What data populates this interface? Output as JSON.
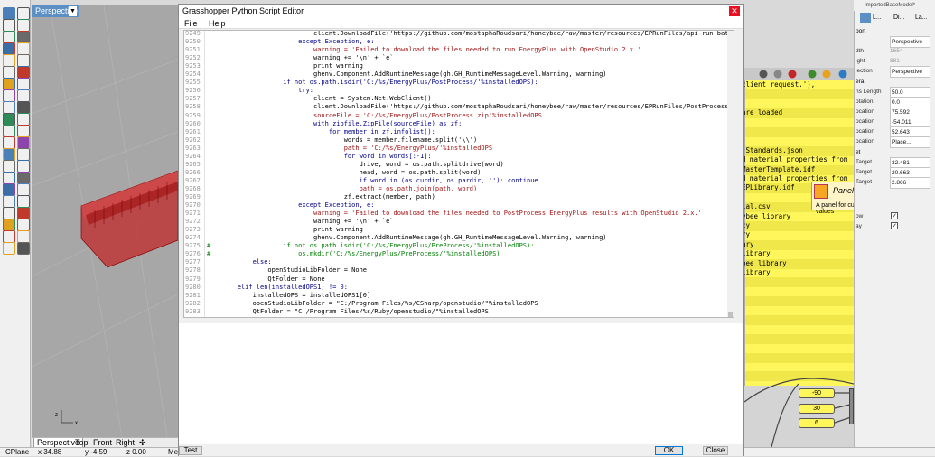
{
  "rhino": {
    "viewport_label": "Perspective",
    "view_tabs": [
      "Perspective",
      "Top",
      "Front",
      "Right"
    ],
    "status": {
      "cplane": "CPlane",
      "x": "x 34.88",
      "y": "y -4.59",
      "z": "z 0.00",
      "units": "Me"
    }
  },
  "editor": {
    "title": "Grasshopper Python Script Editor",
    "menu": [
      "File",
      "Help"
    ],
    "test_label": "Test",
    "ok_label": "OK",
    "close_label": "Close",
    "line_numbers": [
      "9249",
      "9250",
      "9251",
      "9252",
      "9253",
      "9254",
      "9255",
      "9256",
      "9257",
      "9258",
      "9259",
      "9260",
      "9261",
      "9262",
      "9263",
      "9264",
      "9265",
      "9266",
      "9267",
      "9268",
      "9269",
      "9270",
      "9271",
      "9272",
      "9273",
      "9274",
      "9275",
      "9276",
      "9277",
      "9278",
      "9279",
      "9280",
      "9281",
      "9282",
      "9283"
    ],
    "code_lines": [
      "                            client.DownloadFile('https://github.com/mostaphaRoudsari/honeybee/raw/master/resources/EPRunFiles/api-run.bat",
      "                        except Exception, e:",
      "                            warning = 'Failed to download the files needed to run EnergyPlus with OpenStudio 2.x.'",
      "                            warning += '\\n' + `e`",
      "                            print warning",
      "                            ghenv.Component.AddRuntimeMessage(gh.GH_RuntimeMessageLevel.Warning, warning)",
      "                    if not os.path.isdir('C:/%s/EnergyPlus/PostProcess/'%installedOPS):",
      "                        try:",
      "                            client = System.Net.WebClient()",
      "                            client.DownloadFile('https://github.com/mostaphaRoudsari/honeybee/raw/master/resources/EPRunFiles/PostProcess",
      "                            sourceFile = 'C:/%s/EnergyPlus/PostProcess.zip'%installedOPS",
      "                            with zipfile.ZipFile(sourceFile) as zf:",
      "                                for member in zf.infolist():",
      "                                    words = member.filename.split('\\\\')",
      "                                    path = 'C:/%s/EnergyPlus/'%installedOPS",
      "                                    for word in words[:-1]:",
      "                                        drive, word = os.path.splitdrive(word)",
      "                                        head, word = os.path.split(word)",
      "                                        if word in (os.curdir, os.pardir, ''): continue",
      "                                        path = os.path.join(path, word)",
      "                                    zf.extract(member, path)",
      "                        except Exception, e:",
      "                            warning = 'Failed to download the files needed to PostProcess EnergyPlus results with OpenStudio 2.x.'",
      "                            warning += '\\n' + `e`",
      "                            print warning",
      "                            ghenv.Component.AddRuntimeMessage(gh.GH_RuntimeMessageLevel.Warning, warning)",
      "#                   if not os.path.isdir('C:/%s/EnergyPlus/PreProcess/'%installedOPS):",
      "#                       os.mkdir('C:/%s/EnergyPlus/PreProcess/'%installedOPS)",
      "            else:",
      "                openStudioLibFolder = None",
      "                QtFolder = None",
      "        elif len(installedOPS1) != 0:",
      "            installedOPS = installedOPS1[0]",
      "            openStudioLibFolder = \"C:/Program Files/%s/CSharp/openstudio/\"%installedOPS",
      "            QtFolder = \"C:/Program Files/%s/Ruby/openstudio/\"%installedOPS"
    ]
  },
  "grasshopper": {
    "panel_lines": [
      "client request.'),",
      "",
      "",
      "are loaded",
      "",
      "",
      "",
      "_Standards.json",
      "d material properties from",
      "MasterTemplate.idf",
      "d material properties from",
      "EPLibrary.idf",
      "",
      "ial.csv",
      "ybee library",
      "cy",
      "ry",
      "ary",
      "library",
      "bee library",
      "library"
    ],
    "sliders": [
      "-90",
      "30",
      "6"
    ],
    "tooltip": {
      "title": "Panel ()",
      "description": "A panel for custom notes and text values"
    }
  },
  "properties": {
    "window_title": "ImportedBaseModel*",
    "tabs": [
      "L...",
      "Di...",
      "La..."
    ],
    "section_viewport": "port",
    "rows": [
      {
        "key": "",
        "value": "Perspective"
      },
      {
        "key": "dth",
        "value": "1654"
      },
      {
        "key": "ight",
        "value": "881"
      },
      {
        "key": "jection",
        "value": "Perspective"
      }
    ],
    "section_camera": "era",
    "camera_rows": [
      {
        "key": "ns Length",
        "value": "50.0"
      },
      {
        "key": "otation",
        "value": "0.0"
      },
      {
        "key": "ocation",
        "value": "75.592"
      },
      {
        "key": "ocation",
        "value": "-54.011"
      },
      {
        "key": "ocation",
        "value": "52.643"
      },
      {
        "key": "ocation",
        "value": "Place..."
      }
    ],
    "section_target": "et",
    "target_rows": [
      {
        "key": "Target",
        "value": "32.481"
      },
      {
        "key": "Target",
        "value": "20.663"
      },
      {
        "key": "Target",
        "value": "2.866"
      }
    ],
    "check_rows": [
      "ow",
      "ay"
    ]
  }
}
